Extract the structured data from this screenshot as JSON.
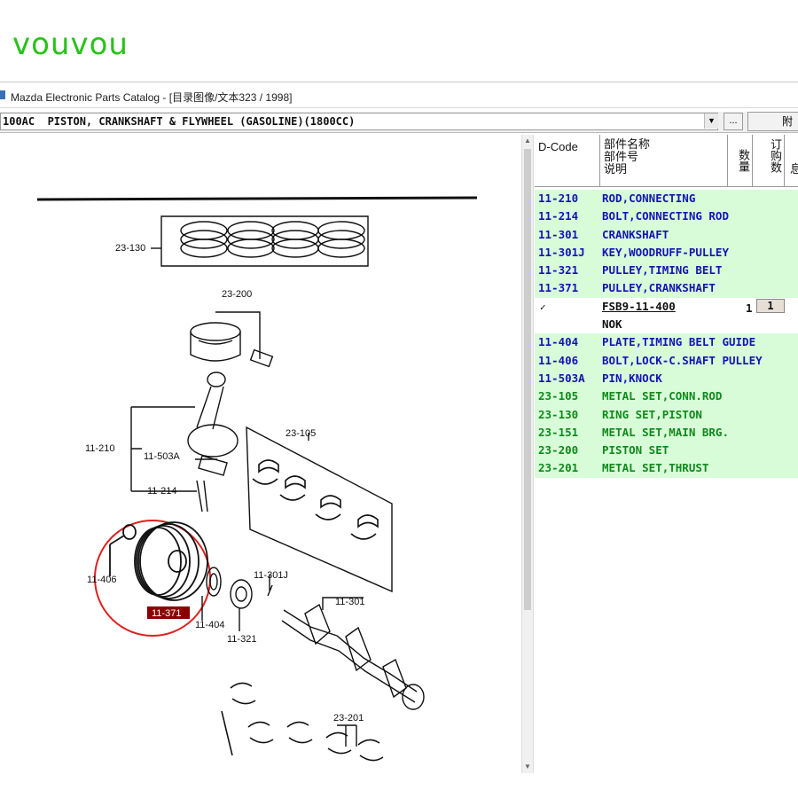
{
  "watermark": "vouvou",
  "window": {
    "title": "Mazda Electronic Parts Catalog - [目录图像/文本323 / 1998]"
  },
  "toolbar": {
    "selected_section": "100AC  PISTON, CRANKSHAFT & FLYWHEEL (GASOLINE)(1800CC)",
    "more_label": "...",
    "attach_label": "附"
  },
  "diagram": {
    "callouts": [
      "23-130",
      "23-200",
      "11-210",
      "11-503A",
      "11-214",
      "23-105",
      "11-406",
      "11-371",
      "11-404",
      "11-321",
      "11-301J",
      "11-301",
      "23-201"
    ],
    "highlighted": "11-371"
  },
  "grid": {
    "headers": {
      "dcode": "D-Code",
      "name": [
        "部件名称",
        "部件号",
        "说明"
      ],
      "qty": "数量",
      "order": "订购数",
      "extra": "息"
    },
    "rows": [
      {
        "code": "11-210",
        "name": "ROD,CONNECTING",
        "style": "green"
      },
      {
        "code": "11-214",
        "name": "BOLT,CONNECTING ROD",
        "style": "green"
      },
      {
        "code": "11-301",
        "name": "CRANKSHAFT",
        "style": "green"
      },
      {
        "code": "11-301J",
        "name": "KEY,WOODRUFF-PULLEY",
        "style": "green"
      },
      {
        "code": "11-321",
        "name": "PULLEY,TIMING BELT",
        "style": "green"
      },
      {
        "code": "11-371",
        "name": "PULLEY,CRANKSHAFT",
        "style": "green"
      }
    ],
    "selected_part": {
      "checked": "✓",
      "part_number": "FSB9-11-400",
      "qty": "1",
      "order": "1",
      "note": "NOK"
    },
    "rows2": [
      {
        "code": "11-404",
        "name": "PLATE,TIMING BELT GUIDE"
      },
      {
        "code": "11-406",
        "name": "BOLT,LOCK-C.SHAFT PULLEY"
      },
      {
        "code": "11-503A",
        "name": "PIN,KNOCK"
      }
    ],
    "rows3": [
      {
        "code": "23-105",
        "name": "METAL SET,CONN.ROD"
      },
      {
        "code": "23-130",
        "name": "RING SET,PISTON"
      },
      {
        "code": "23-151",
        "name": "METAL SET,MAIN BRG."
      },
      {
        "code": "23-200",
        "name": "PISTON SET"
      },
      {
        "code": "23-201",
        "name": "METAL SET,THRUST"
      }
    ]
  },
  "colors": {
    "row_bg": "#d8fbd8",
    "code_blue": "#1414b8",
    "code_green": "#0f8a1c",
    "highlight": "#8b0000",
    "circle": "#e02020"
  }
}
